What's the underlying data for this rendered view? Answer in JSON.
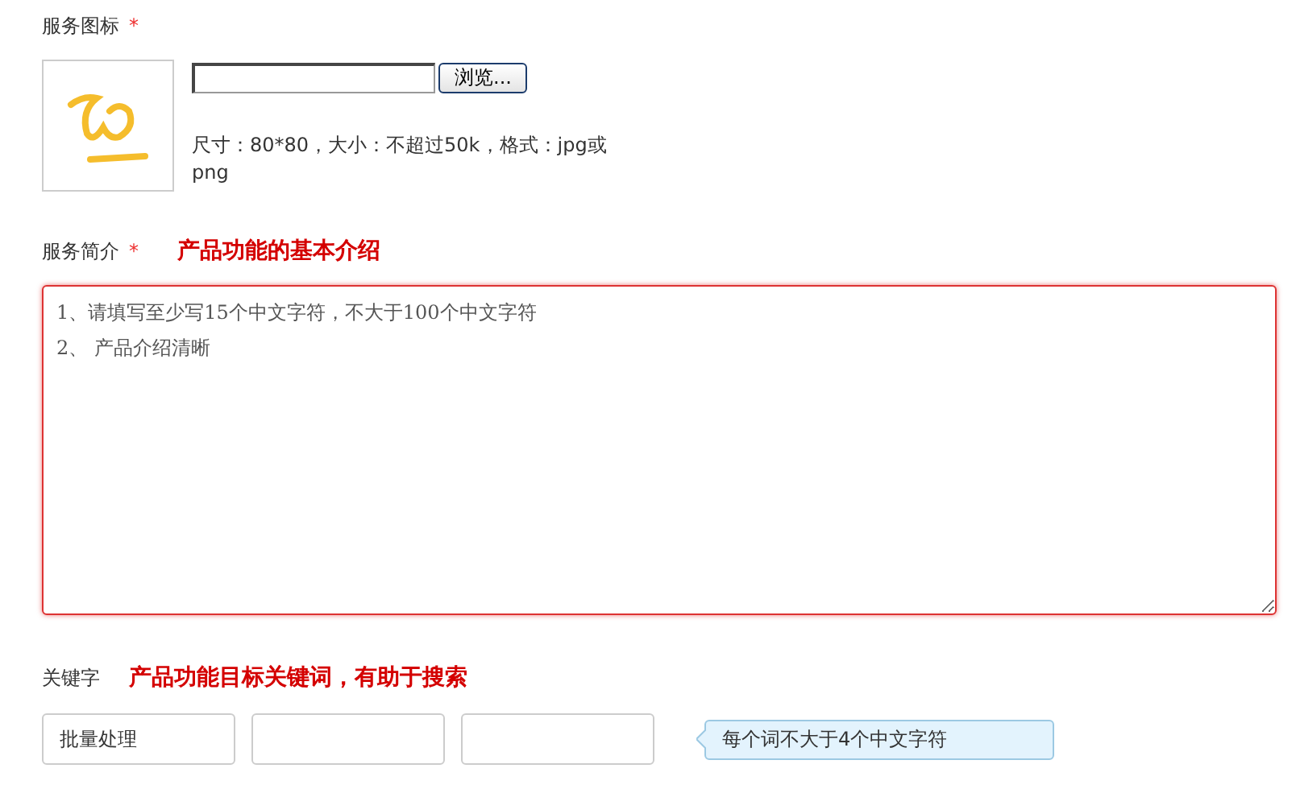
{
  "icon_section": {
    "label": "服务图标",
    "required_mark": "*",
    "file_button": "浏览...",
    "hint": "尺寸：80*80，大小：不超过50k，格式：jpg或png"
  },
  "intro_section": {
    "label": "服务简介",
    "required_mark": "*",
    "note": "产品功能的基本介绍",
    "value": "1、请填写至少写15个中文字符，不大于100个中文字符\n2、 产品介绍清晰",
    "error": true
  },
  "keyword_section": {
    "label": "关键字",
    "note": "产品功能目标关键词，有助于搜索",
    "fields": [
      {
        "kind": "input",
        "value": "批量处理"
      },
      {
        "kind": "input"
      },
      {
        "kind": "input"
      }
    ],
    "tooltip": "每个词不大于4个中文字符"
  }
}
